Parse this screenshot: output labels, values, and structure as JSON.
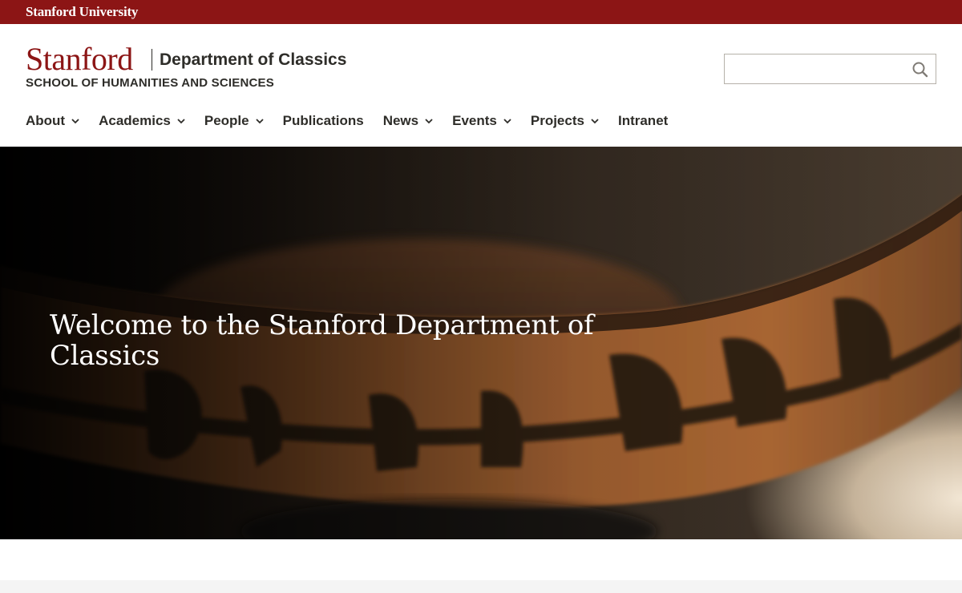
{
  "global_bar": {
    "link": "Stanford University",
    "color": "#8c1515"
  },
  "lockup": {
    "wordmark": "Stanford",
    "department": "Department of Classics",
    "school": "SCHOOL OF HUMANITIES AND SCIENCES"
  },
  "search": {
    "value": "",
    "placeholder": "",
    "icon": "search-icon"
  },
  "nav": {
    "items": [
      {
        "label": "About",
        "has_dropdown": true
      },
      {
        "label": "Academics",
        "has_dropdown": true
      },
      {
        "label": "People",
        "has_dropdown": true
      },
      {
        "label": "Publications",
        "has_dropdown": false
      },
      {
        "label": "News",
        "has_dropdown": true
      },
      {
        "label": "Events",
        "has_dropdown": true
      },
      {
        "label": "Projects",
        "has_dropdown": true
      },
      {
        "label": "Intranet",
        "has_dropdown": false
      }
    ]
  },
  "hero": {
    "title": "Welcome to the Stanford Department of Classics",
    "image": "ancient-greek-kylix-photo"
  },
  "colors": {
    "cardinal": "#8c1515",
    "text": "#2e2d29",
    "strip": "#f4f4f4"
  }
}
